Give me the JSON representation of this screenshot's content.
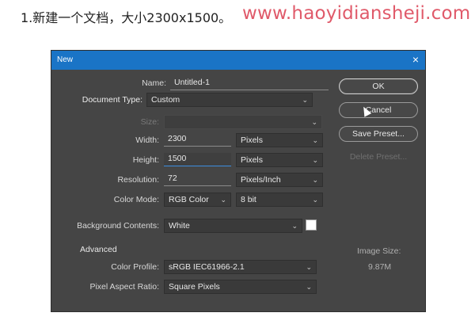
{
  "caption": "1.新建一个文档，大小2300x1500。",
  "site": "www.haoyidiansheji.com",
  "dialog": {
    "title": "New",
    "close_icon": "×",
    "name": {
      "label": "Name:",
      "value": "Untitled-1"
    },
    "doc_type": {
      "label": "Document Type:",
      "value": "Custom"
    },
    "size": {
      "label": "Size:",
      "value": ""
    },
    "width": {
      "label": "Width:",
      "value": "2300",
      "unit": "Pixels"
    },
    "height": {
      "label": "Height:",
      "value": "1500",
      "unit": "Pixels"
    },
    "resolution": {
      "label": "Resolution:",
      "value": "72",
      "unit": "Pixels/Inch"
    },
    "color_mode": {
      "label": "Color Mode:",
      "value": "RGB Color",
      "depth": "8 bit"
    },
    "background": {
      "label": "Background Contents:",
      "value": "White",
      "swatch_color": "#ffffff"
    },
    "advanced": {
      "label": "Advanced"
    },
    "color_profile": {
      "label": "Color Profile:",
      "value": "sRGB IEC61966-2.1"
    },
    "pixel_aspect": {
      "label": "Pixel Aspect Ratio:",
      "value": "Square Pixels"
    },
    "image_size": {
      "label": "Image Size:",
      "value": "9.87M"
    },
    "buttons": {
      "ok": "OK",
      "cancel": "Cancel",
      "save_preset": "Save Preset...",
      "delete_preset": "Delete Preset..."
    }
  },
  "colors": {
    "titlebar": "#1a74c6",
    "dialog_bg": "#454545",
    "site_text": "#e05a6a"
  }
}
